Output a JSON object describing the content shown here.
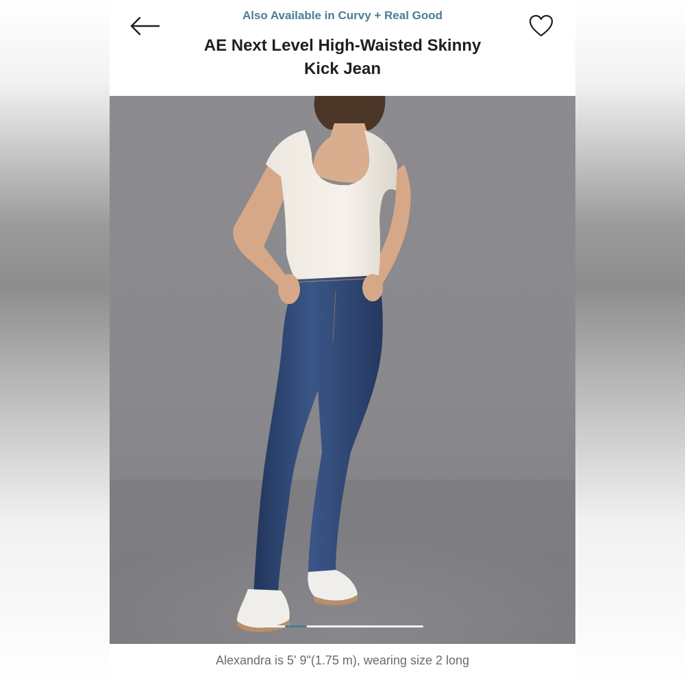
{
  "header": {
    "back_icon": "arrow-left-icon",
    "wishlist_icon": "heart-outline-icon",
    "also_available": "Also Available in Curvy + Real Good",
    "title_line1": "AE Next Level High-Waisted Skinny",
    "title_line2": "Kick Jean"
  },
  "colors": {
    "accent": "#4a7d96",
    "title": "#1f1f1f",
    "caption": "#6b6b6b",
    "backdrop": "#8a898d",
    "denim": "#2a3e66"
  },
  "gallery": {
    "slide_count": 7,
    "active_slide": 2
  },
  "caption": "Alexandra is 5' 9\"(1.75 m), wearing size 2 long"
}
